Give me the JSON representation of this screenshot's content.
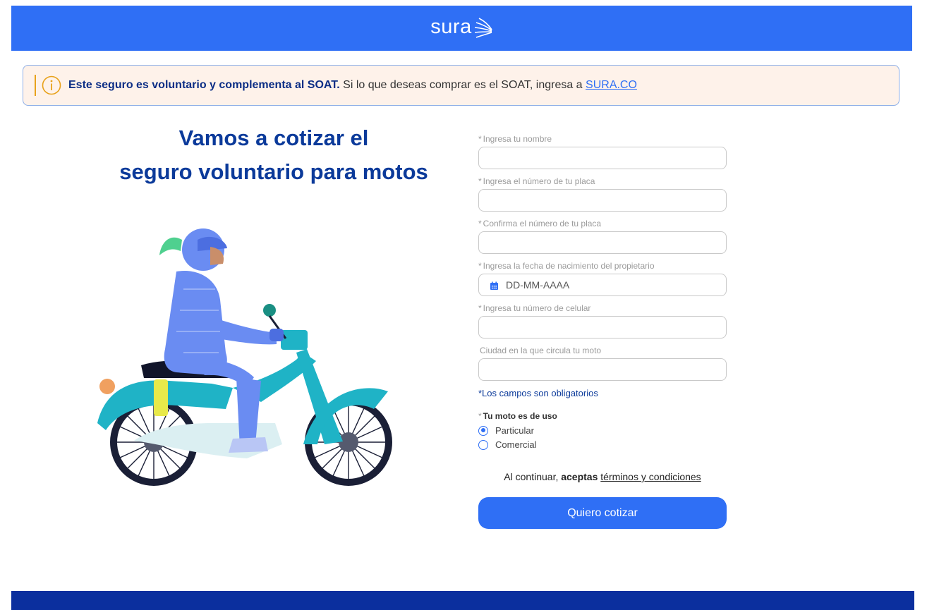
{
  "header": {
    "logo_text": "sura"
  },
  "notice": {
    "bold_text": "Este seguro es voluntario y complementa al SOAT.",
    "text": " Si lo que deseas comprar es el SOAT, ingresa a ",
    "link": "SURA.CO"
  },
  "heading": {
    "line1": "Vamos a cotizar el",
    "line2": "seguro voluntario para motos"
  },
  "form": {
    "fields": [
      {
        "required": "*",
        "label": "Ingresa tu nombre"
      },
      {
        "required": "*",
        "label": "Ingresa el número de tu placa"
      },
      {
        "required": "*",
        "label": "Confirma el número de tu placa"
      },
      {
        "required": "*",
        "label": "Ingresa la fecha de nacimiento del propietario",
        "placeholder": "DD-MM-AAAA"
      },
      {
        "required": "*",
        "label": "Ingresa tu número de celular"
      },
      {
        "required": "",
        "label": "Ciudad en la que circula tu moto"
      }
    ],
    "required_note": "*Los campos son obligatorios",
    "use_question": {
      "required": "*",
      "label": "Tu moto es de uso"
    },
    "use_options": [
      "Particular",
      "Comercial"
    ],
    "use_selected": "Particular",
    "terms": {
      "prefix": "Al continuar, ",
      "bold": "aceptas",
      "link": "términos y condiciones"
    },
    "submit_label": "Quiero cotizar"
  },
  "colors": {
    "brand_blue": "#2f6ff5",
    "navy": "#0b3a9a",
    "footer": "#0b2f9e",
    "notice_bg": "#fef2ea",
    "notice_accent": "#e8a21b"
  },
  "icons": [
    "sura-logo-icon",
    "info-icon",
    "calendar-icon"
  ]
}
